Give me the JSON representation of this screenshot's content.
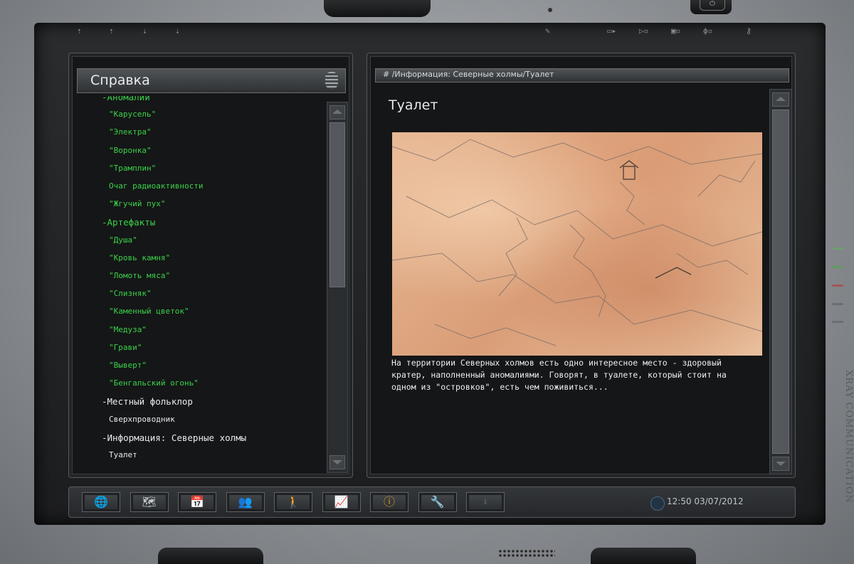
{
  "left_panel": {
    "title": "Справка",
    "items": [
      {
        "label": "-Аномалии",
        "level": 0,
        "color": "#39d24a"
      },
      {
        "label": "\"Карусель\"",
        "level": 1,
        "color": "#39d24a"
      },
      {
        "label": "\"Электра\"",
        "level": 1,
        "color": "#39d24a"
      },
      {
        "label": "\"Воронка\"",
        "level": 1,
        "color": "#39d24a"
      },
      {
        "label": "\"Трамплин\"",
        "level": 1,
        "color": "#39d24a"
      },
      {
        "label": "Очаг радиоактивности",
        "level": 1,
        "color": "#39d24a"
      },
      {
        "label": "\"Жгучий пух\"",
        "level": 1,
        "color": "#39d24a"
      },
      {
        "label": "-Артефакты",
        "level": 0,
        "color": "#39d24a"
      },
      {
        "label": "\"Душа\"",
        "level": 1,
        "color": "#39d24a"
      },
      {
        "label": "\"Кровь камня\"",
        "level": 1,
        "color": "#39d24a"
      },
      {
        "label": "\"Ломоть мяса\"",
        "level": 1,
        "color": "#39d24a"
      },
      {
        "label": "\"Слизняк\"",
        "level": 1,
        "color": "#39d24a"
      },
      {
        "label": "\"Каменный цветок\"",
        "level": 1,
        "color": "#39d24a"
      },
      {
        "label": "\"Медуза\"",
        "level": 1,
        "color": "#39d24a"
      },
      {
        "label": "\"Грави\"",
        "level": 1,
        "color": "#39d24a"
      },
      {
        "label": "\"Выверт\"",
        "level": 1,
        "color": "#39d24a"
      },
      {
        "label": "\"Бенгальский огонь\"",
        "level": 1,
        "color": "#39d24a"
      },
      {
        "label": "-Местный фольклор",
        "level": 0,
        "color": "#e8eaec"
      },
      {
        "label": "Сверхпроводник",
        "level": 1,
        "color": "#e8eaec"
      },
      {
        "label": "-Информация: Северные холмы",
        "level": 0,
        "color": "#e8eaec"
      },
      {
        "label": "Туалет",
        "level": 1,
        "color": "#e8eaec"
      }
    ],
    "scroll_position": 0.45
  },
  "right_panel": {
    "breadcrumb": "# /Информация: Северные холмы/Туалет",
    "title": "Туалет",
    "description": "На территории Северных холмов есть одно интересное место - здоровый кратер, наполненный аномалиями. Говорят, в туалете, который стоит на одном из \"островков\", есть чем поживиться..."
  },
  "bottom_bar": {
    "buttons": [
      {
        "name": "map-globe",
        "icon": "🌐"
      },
      {
        "name": "map",
        "icon": "🗺"
      },
      {
        "name": "calendar",
        "icon": "📅"
      },
      {
        "name": "contacts",
        "icon": "👥"
      },
      {
        "name": "character",
        "icon": "🚶"
      },
      {
        "name": "statistics",
        "icon": "📈"
      },
      {
        "name": "info",
        "icon": "ⓘ",
        "active": true
      },
      {
        "name": "settings",
        "icon": "🔧"
      },
      {
        "name": "download",
        "icon": "⬇",
        "disabled": true
      }
    ],
    "time": "12:50",
    "date": "03/07/2012"
  },
  "device": {
    "side_label": "XRAY COMMUNICATION"
  }
}
